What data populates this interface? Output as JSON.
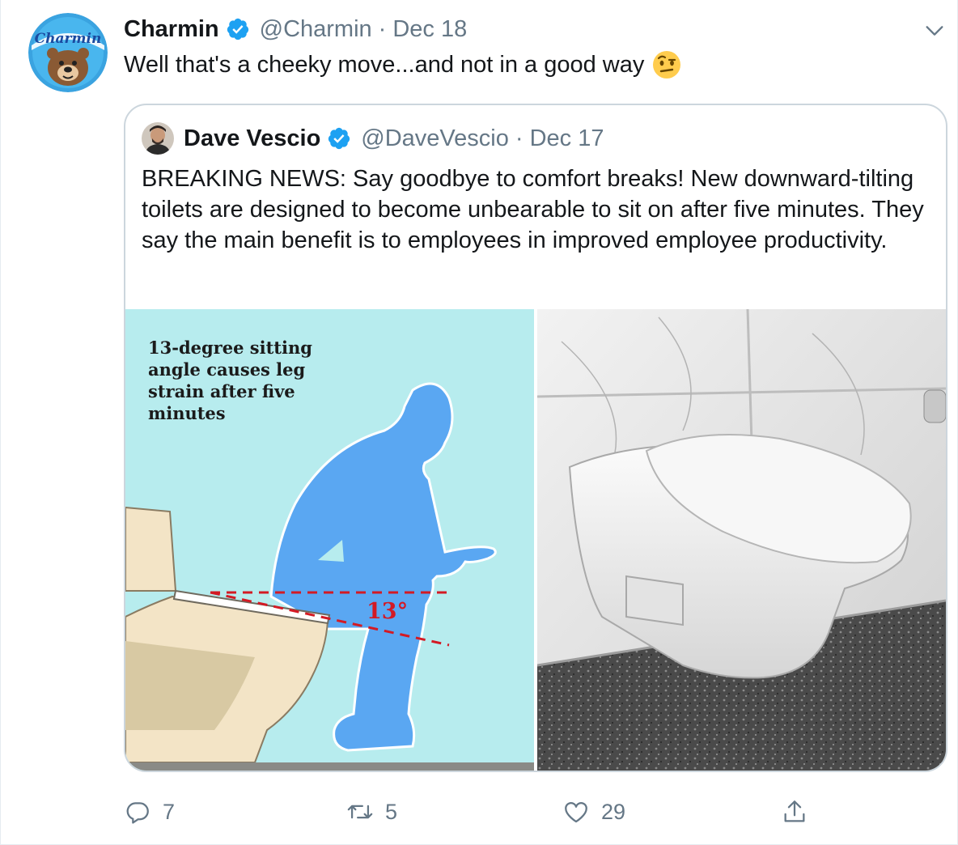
{
  "tweet": {
    "author_name": "Charmin",
    "author_handle": "@Charmin",
    "separator": "·",
    "date": "Dec 18",
    "text": "Well that's a cheeky move...and not in a good way",
    "avatar_logo_text": "Charmin",
    "emoji": "face-with-raised-eyebrow",
    "quoted": {
      "author_name": "Dave Vescio",
      "author_handle": "@DaveVescio",
      "separator": "·",
      "date": "Dec 17",
      "text": "BREAKING NEWS: Say goodbye to comfort breaks! New downward-tilting toilets are designed to become unbearable to sit on after five minutes. They say the main benefit is to employees in improved employee productivity.",
      "media": {
        "illustration_caption": "13-degree sitting angle causes leg strain after five minutes",
        "angle_label": "13°"
      }
    },
    "actions": {
      "replies": "7",
      "retweets": "5",
      "likes": "29"
    }
  },
  "colors": {
    "verified": "#1da1f2",
    "text_primary": "#14171a",
    "text_secondary": "#657786",
    "border": "#ccd6dd",
    "illustration_bg": "#b7ecee",
    "silhouette": "#5aa7f2",
    "angle_red": "#d31a24"
  },
  "icons": [
    "verified-badge-icon",
    "chevron-down-icon",
    "reply-icon",
    "retweet-icon",
    "like-icon",
    "share-icon"
  ]
}
